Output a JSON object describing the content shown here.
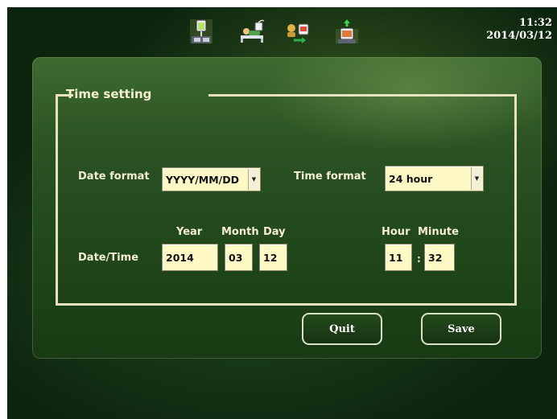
{
  "status_bar": {
    "icons": [
      "infusion-bag-icon",
      "patient-bed-icon",
      "transfer-icon",
      "device-upload-icon"
    ],
    "time": "11:32",
    "date": "2014/03/12"
  },
  "time_setting": {
    "title": "Time setting",
    "date_format": {
      "label": "Date format",
      "value": "YYYY/MM/DD"
    },
    "time_format": {
      "label": "Time format",
      "value": "24 hour"
    },
    "date_time": {
      "label": "Date/Time",
      "year_label": "Year",
      "month_label": "Month",
      "day_label": "Day",
      "hour_label": "Hour",
      "minute_label": "Minute",
      "year": "2014",
      "month": "03",
      "day": "12",
      "hour": "11",
      "separator": ":",
      "minute": "32"
    }
  },
  "buttons": {
    "quit": "Quit",
    "save": "Save"
  },
  "colors": {
    "panel": "#2a5223",
    "frame": "#e9e2bf",
    "field": "#fff9c6",
    "text": "#f4eecf"
  }
}
